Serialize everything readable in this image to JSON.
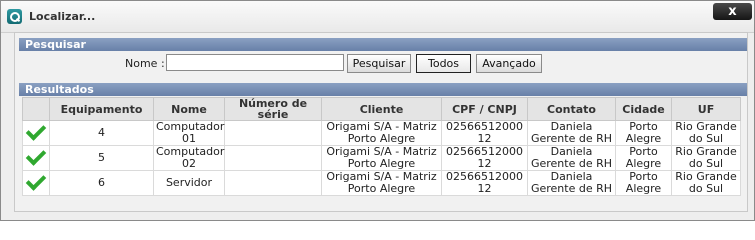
{
  "window": {
    "title": "Localizar...",
    "close_label": "x"
  },
  "search": {
    "section_title": "Pesquisar",
    "nome_label": "Nome :",
    "nome_value": "",
    "buttons": {
      "pesquisar": "Pesquisar",
      "todos": "Todos",
      "avancado": "Avançado"
    }
  },
  "results": {
    "section_title": "Resultados",
    "columns": [
      "",
      "Equipamento",
      "Nome",
      "Número de série",
      "Cliente",
      "CPF / CNPJ",
      "Contato",
      "Cidade",
      "UF"
    ],
    "rows": [
      {
        "status_icon": "check-icon",
        "equipamento": "4",
        "nome": "Computador 01",
        "serie": "",
        "cliente": "Origami S/A - Matriz Porto Alegre",
        "cpf_cnpj": "02566512000 12",
        "contato": "Daniela Gerente de RH",
        "cidade": "Porto Alegre",
        "uf": "Rio Grande do Sul"
      },
      {
        "status_icon": "check-icon",
        "equipamento": "5",
        "nome": "Computador 02",
        "serie": "",
        "cliente": "Origami S/A - Matriz Porto Alegre",
        "cpf_cnpj": "02566512000 12",
        "contato": "Daniela Gerente de RH",
        "cidade": "Porto Alegre",
        "uf": "Rio Grande do Sul"
      },
      {
        "status_icon": "check-icon",
        "equipamento": "6",
        "nome": "Servidor",
        "serie": "",
        "cliente": "Origami S/A - Matriz Porto Alegre",
        "cpf_cnpj": "02566512000 12",
        "contato": "Daniela Gerente de RH",
        "cidade": "Porto Alegre",
        "uf": "Rio Grande do Sul"
      }
    ]
  },
  "colors": {
    "section_header": "#6f88af",
    "check": "#2fa82f",
    "close_button": "#222222"
  }
}
